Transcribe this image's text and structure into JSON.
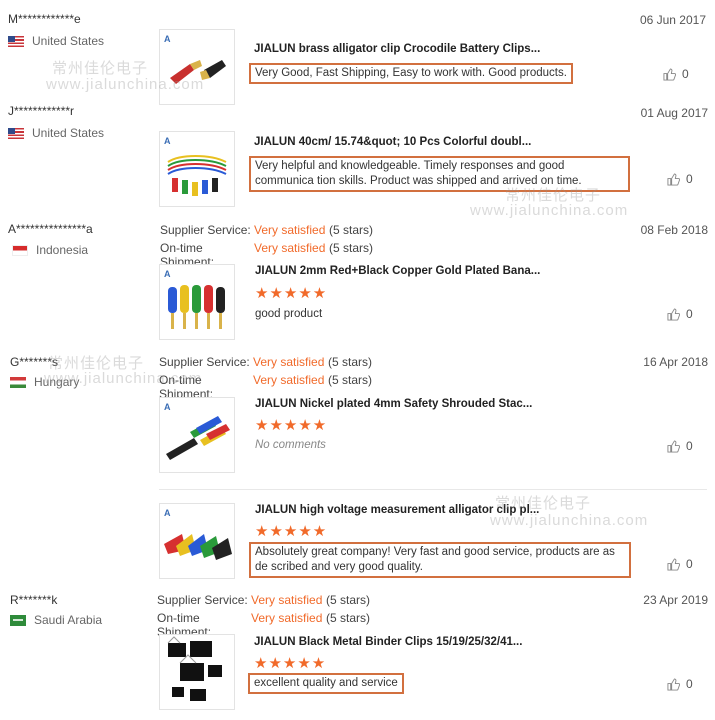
{
  "reviews": [
    {
      "buyer": "M************e",
      "country": "United States",
      "flag": "us",
      "date": "06 Jun 2017",
      "items": [
        {
          "title": "JIALUN brass alligator clip Crocodile Battery Clips...",
          "comment": "Very Good, Fast Shipping, Easy to work with. Good products.",
          "likes": "0"
        }
      ]
    },
    {
      "buyer": "J************r",
      "country": "United States",
      "flag": "us",
      "date": "01 Aug 2017",
      "items": [
        {
          "title": "JIALUN 40cm/ 15.74&quot; 10 Pcs Colorful doubl...",
          "comment": "Very helpful and knowledgeable. Timely responses and good communica tion skills. Product was shipped and arrived on time.",
          "likes": "0"
        }
      ]
    },
    {
      "buyer": "A***************a",
      "country": "Indonesia",
      "flag": "id",
      "date": "08 Feb 2018",
      "supplier_service_label": "Supplier Service:",
      "supplier_service_value": "Very satisfied",
      "supplier_service_stars": "(5 stars)",
      "shipment_label": "On-time Shipment:",
      "shipment_value": "Very satisfied",
      "shipment_stars": "(5 stars)",
      "items": [
        {
          "title": "JIALUN 2mm Red+Black Copper Gold Plated Bana...",
          "stars": "★★★★★",
          "comment": "good product",
          "likes": "0"
        }
      ]
    },
    {
      "buyer": "G*******s",
      "country": "Hungary",
      "flag": "hu",
      "date": "16 Apr 2018",
      "supplier_service_label": "Supplier Service:",
      "supplier_service_value": "Very satisfied",
      "supplier_service_stars": "(5 stars)",
      "shipment_label": "On-time Shipment:",
      "shipment_value": "Very satisfied",
      "shipment_stars": "(5 stars)",
      "items": [
        {
          "title": "JIALUN Nickel plated 4mm Safety Shrouded Stac...",
          "stars": "★★★★★",
          "comment": "No comments",
          "likes": "0"
        },
        {
          "title": "JIALUN high voltage measurement alligator clip pl...",
          "stars": "★★★★★",
          "comment": "Absolutely great company! Very fast and good service, products are as de scribed and very good quality.",
          "likes": "0"
        }
      ]
    },
    {
      "buyer": "R*******k",
      "country": "Saudi Arabia",
      "flag": "sa",
      "date": "23 Apr 2019",
      "supplier_service_label": "Supplier Service:",
      "supplier_service_value": "Very satisfied",
      "supplier_service_stars": "(5 stars)",
      "shipment_label": "On-time Shipment:",
      "shipment_value": "Very satisfied",
      "shipment_stars": "(5 stars)",
      "items": [
        {
          "title": "JIALUN Black Metal Binder Clips 15/19/25/32/41...",
          "stars": "★★★★★",
          "comment": "excellent quality and service",
          "likes": "0"
        }
      ]
    }
  ],
  "watermark": {
    "cn": "常州佳伦电子",
    "url": "www.jialunchina.com"
  },
  "brand_logo": "A",
  "accent_color": "#f16a2a",
  "highlight_color": "#d2703f"
}
